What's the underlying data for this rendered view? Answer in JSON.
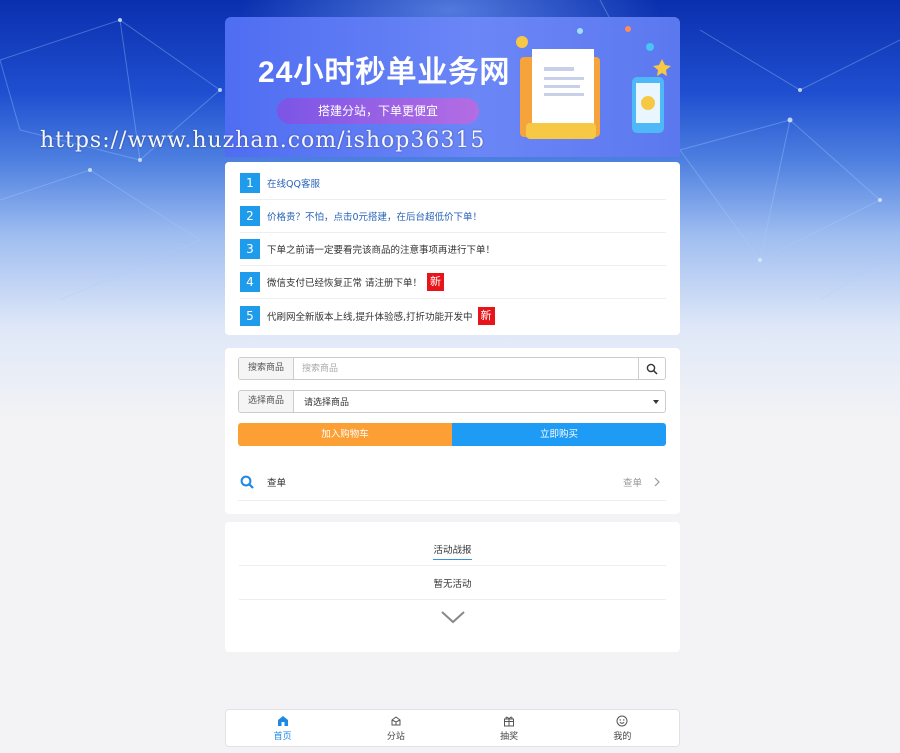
{
  "watermark": "https://www.huzhan.com/ishop36315",
  "banner": {
    "title": "24小时秒单业务网",
    "subtitle": "搭建分站，下单更便宜"
  },
  "notices": [
    {
      "num": "1",
      "text": "在线QQ客服",
      "is_link": true,
      "badge": ""
    },
    {
      "num": "2",
      "text": "价格贵？不怕，点击0元搭建，在后台超低价下单！",
      "is_link": true,
      "badge": ""
    },
    {
      "num": "3",
      "text": "下单之前请一定要看完该商品的注意事项再进行下单！",
      "is_link": false,
      "badge": ""
    },
    {
      "num": "4",
      "text": "微信支付已经恢复正常 请注册下单！",
      "is_link": false,
      "badge": "新"
    },
    {
      "num": "5",
      "text": "代刷网全新版本上线,提升体验感,打折功能开发中",
      "is_link": false,
      "badge": "新"
    }
  ],
  "order": {
    "search_label": "搜索商品",
    "search_placeholder": "搜索商品",
    "select_label": "选择商品",
    "select_value": "请选择商品",
    "cart_button": "加入购物车",
    "buy_button": "立即购买",
    "query_label": "查单",
    "query_action": "查单"
  },
  "activity": {
    "title": "活动战报",
    "empty": "暂无活动"
  },
  "nav": [
    {
      "label": "首页",
      "icon": "home-icon",
      "active": true
    },
    {
      "label": "分站",
      "icon": "cube-icon",
      "active": false
    },
    {
      "label": "抽奖",
      "icon": "gift-icon",
      "active": false
    },
    {
      "label": "我的",
      "icon": "smile-icon",
      "active": false
    }
  ],
  "colors": {
    "accent_blue": "#1e9bea",
    "cart_orange": "#fca035",
    "buy_blue": "#1e9bf5",
    "badge_red": "#e7141a",
    "nav_active": "#1e88e5"
  }
}
